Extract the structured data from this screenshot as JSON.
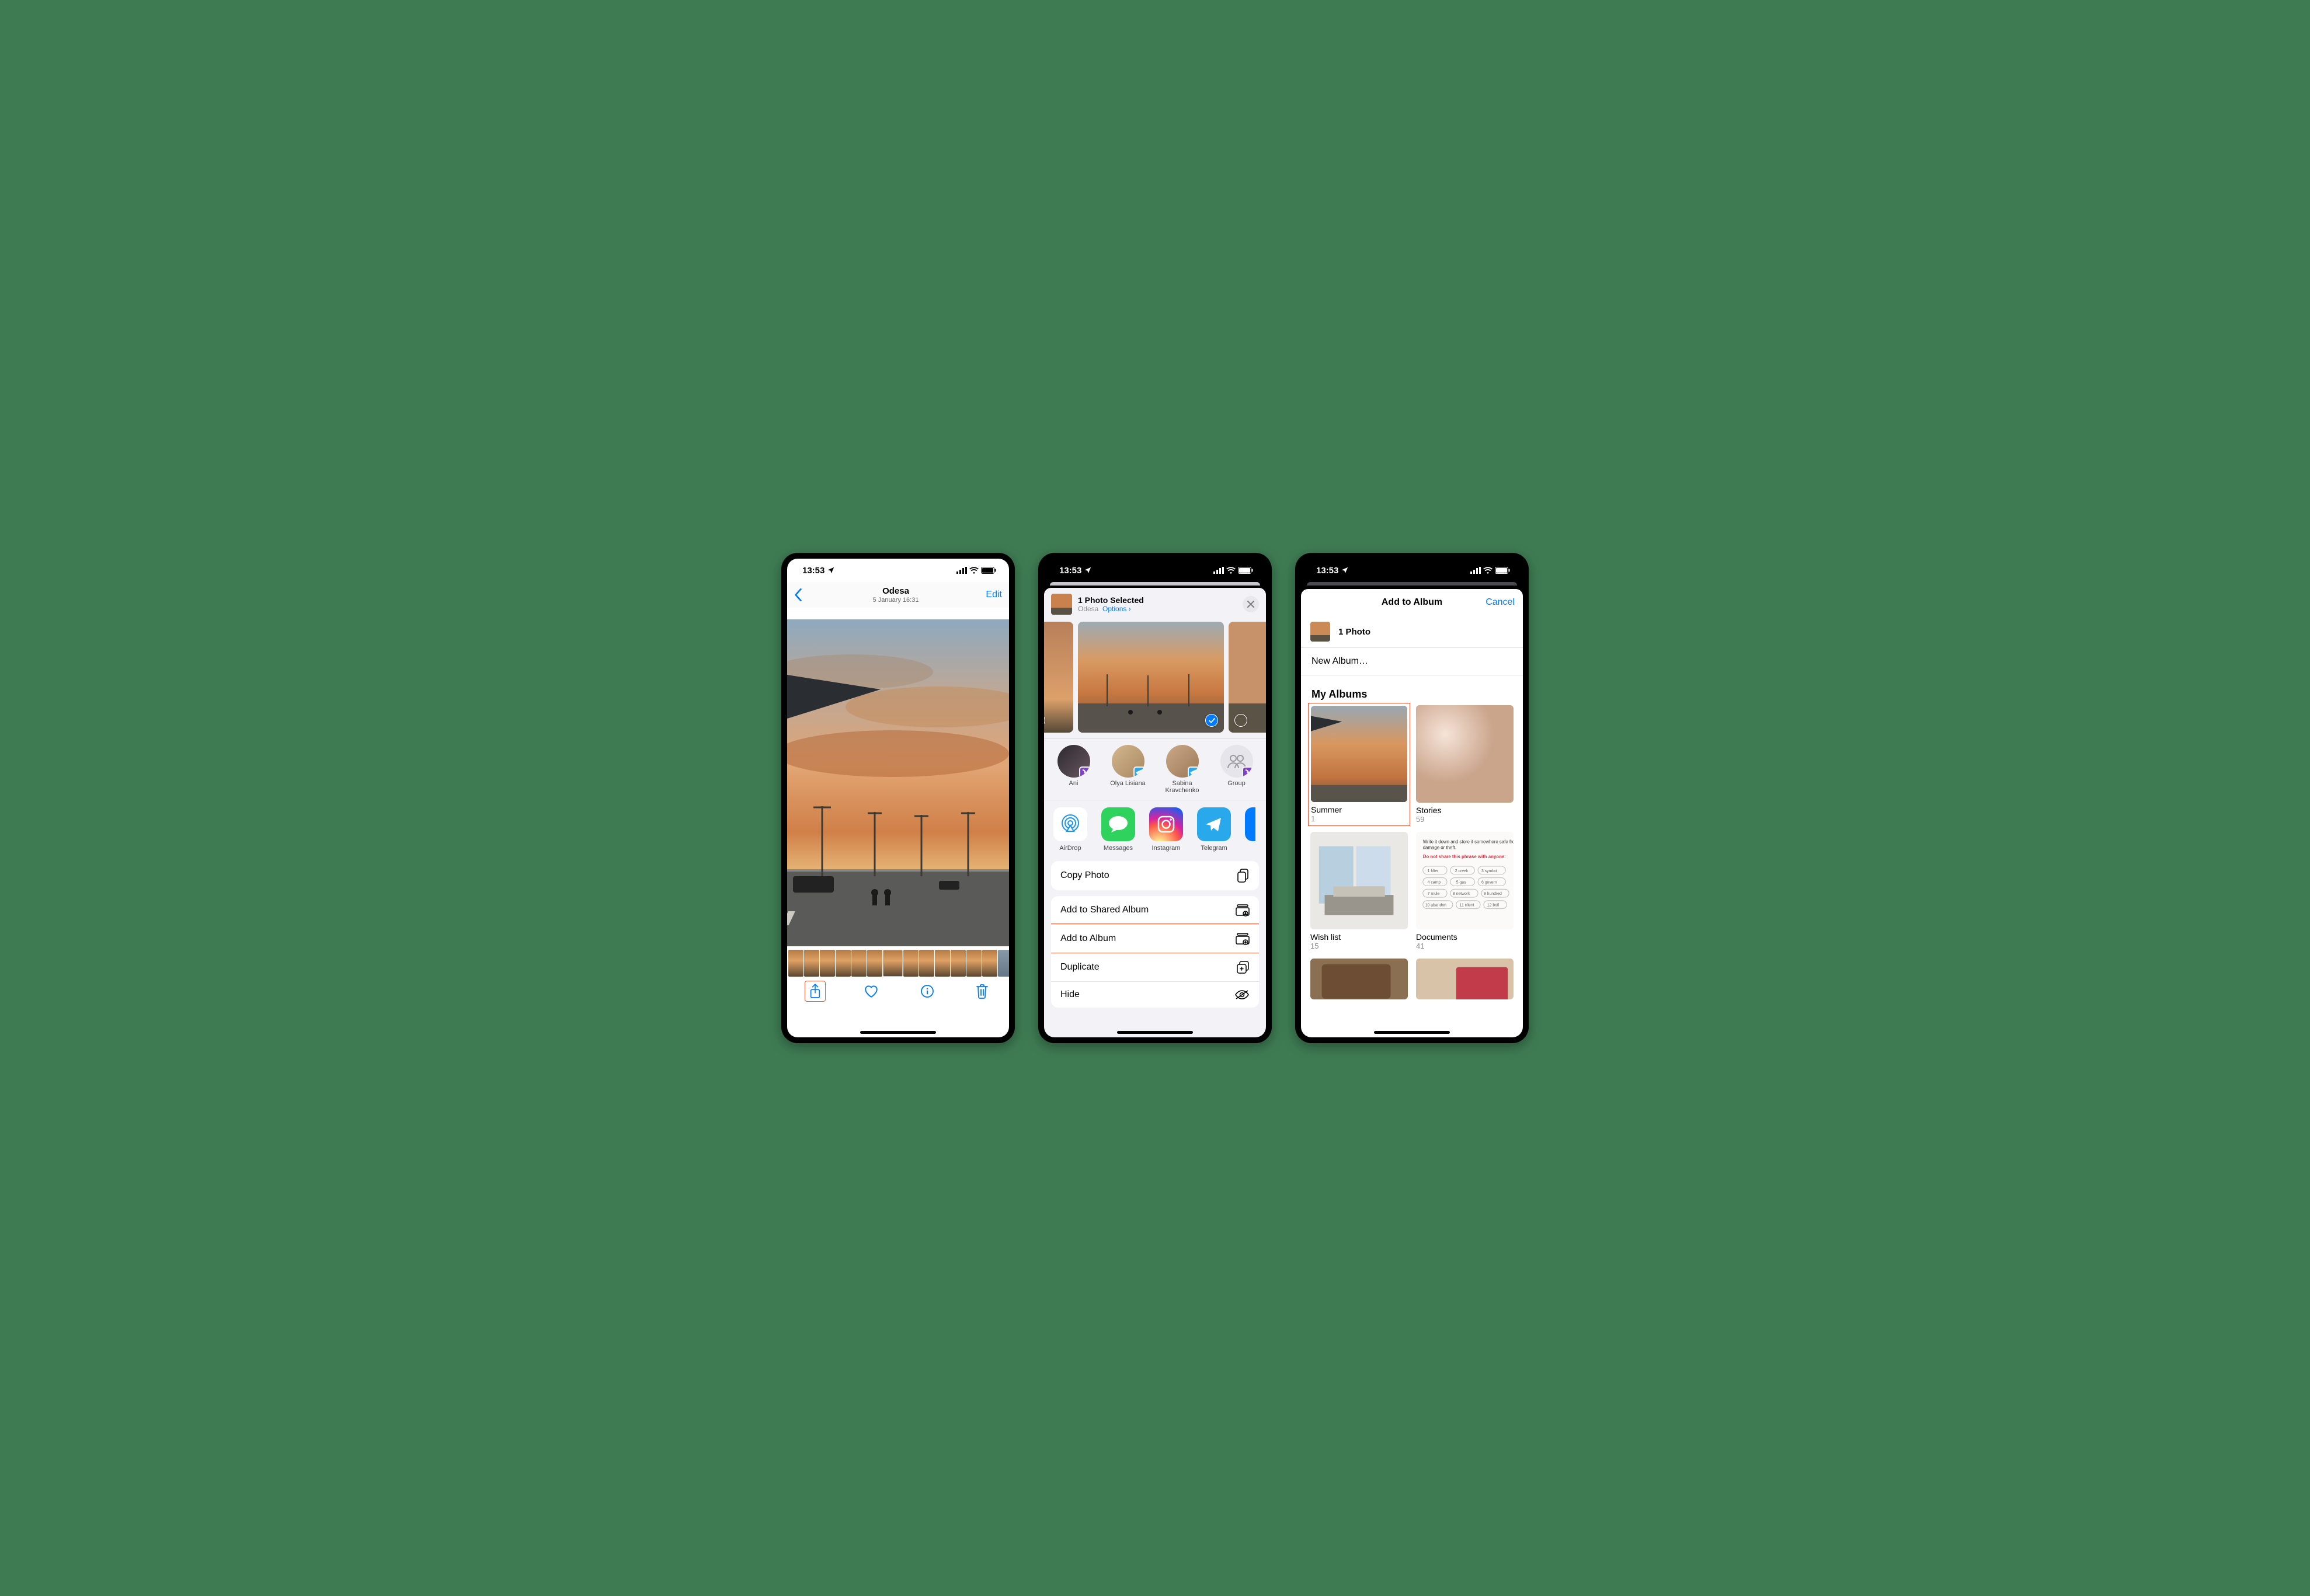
{
  "status": {
    "time": "13:53",
    "cell": "signal",
    "wifi": "wifi",
    "battery": "battery-full"
  },
  "colors": {
    "ios_blue": "#007aff",
    "highlight_red": "#e75b3a",
    "sheet_bg": "#f3f2f7"
  },
  "screen1": {
    "location_title": "Odesa",
    "subtitle": "5 January  16:31",
    "edit_label": "Edit",
    "toolbar_icons": [
      "share-icon",
      "heart-icon",
      "info-icon",
      "trash-icon"
    ]
  },
  "screen2": {
    "header_title": "1 Photo Selected",
    "header_location": "Odesa",
    "header_options": "Options",
    "contacts": [
      {
        "name": "Ani",
        "app": "viber"
      },
      {
        "name": "Olya Lisiana",
        "app": "tg"
      },
      {
        "name": "Sabina Kravchenko",
        "app": "tg"
      },
      {
        "name": "Group",
        "app": "viber"
      }
    ],
    "apps": [
      {
        "name": "AirDrop",
        "icon": "airdrop"
      },
      {
        "name": "Messages",
        "icon": "messages"
      },
      {
        "name": "Instagram",
        "icon": "instagram"
      },
      {
        "name": "Telegram",
        "icon": "telegram"
      }
    ],
    "action1": "Copy Photo",
    "actions2": [
      {
        "label": "Add to Shared Album",
        "icon": "shared-album-icon"
      },
      {
        "label": "Add to Album",
        "icon": "add-album-icon",
        "highlight": true
      },
      {
        "label": "Duplicate",
        "icon": "duplicate-icon"
      },
      {
        "label": "Hide",
        "icon": "hide-icon"
      }
    ]
  },
  "screen3": {
    "title": "Add to Album",
    "cancel": "Cancel",
    "count_label": "1 Photo",
    "new_album": "New Album…",
    "section": "My Albums",
    "albums": [
      {
        "name": "Summer",
        "count": "1",
        "highlight": true
      },
      {
        "name": "Stories",
        "count": "59"
      },
      {
        "name": "Wish list",
        "count": "15"
      },
      {
        "name": "Documents",
        "count": "41"
      }
    ]
  }
}
